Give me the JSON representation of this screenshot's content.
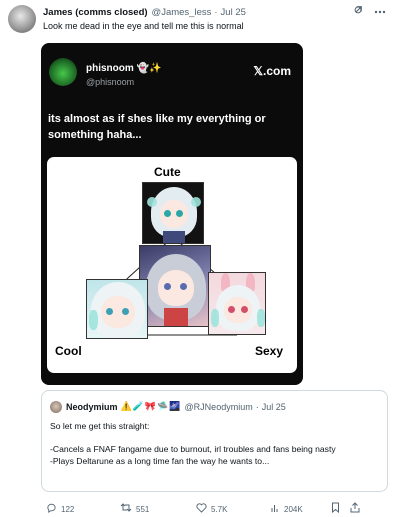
{
  "tweet": {
    "display_name": "James (comms closed)",
    "handle": "@James_less",
    "separator": "·",
    "time": "Jul 25",
    "text": "Look me dead in the eye and tell me this is normal"
  },
  "header_icons": [
    "grok-icon",
    "more-icon"
  ],
  "embedded": {
    "display_name": "phisnoom",
    "name_emojis": "👻✨",
    "handle": "@phisnoom",
    "source": "𝕏.com",
    "text": "its almost as if shes like my everything or something haha...",
    "labels": {
      "top": "Cute",
      "left": "Cool",
      "right": "Sexy"
    }
  },
  "quote": {
    "display_name": "Neodymium",
    "name_emojis": "⚠️🧪🎀🛸🌌",
    "handle": "@RJNeodymium",
    "separator": "·",
    "time": "Jul 25",
    "lines": [
      "So let me get this straight:",
      "-Cancels a FNAF fangame due to burnout, irl troubles and fans being nasty",
      "-Plays Deltarune as a long time fan the way he wants to..."
    ]
  },
  "actions": {
    "replies": "122",
    "reposts": "551",
    "likes": "5.7K",
    "views": "204K"
  },
  "colors": {
    "text_primary": "#0f1419",
    "text_secondary": "#536471",
    "border": "#cfd9de",
    "card_bg": "#0b0b0b"
  }
}
